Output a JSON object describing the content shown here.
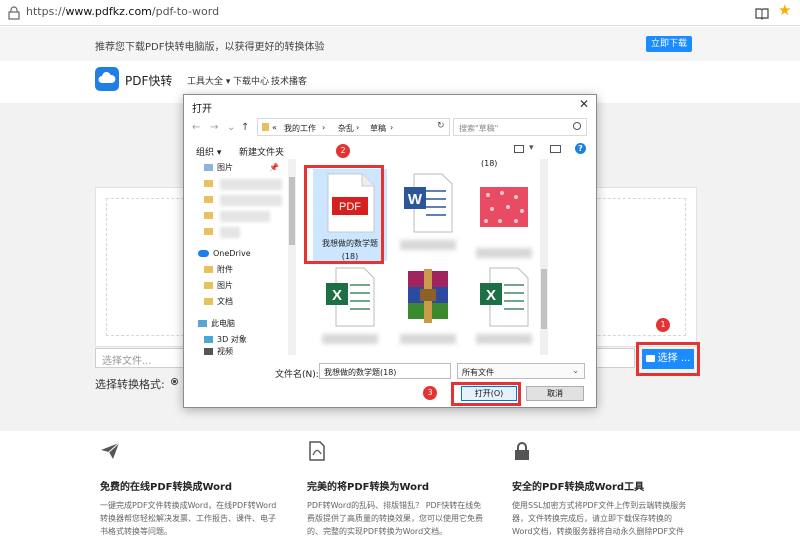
{
  "browser": {
    "url_prefix": "https://",
    "url_domain": "www.pdfkz.com",
    "url_path": "/pdf-to-word"
  },
  "promo": {
    "text": "推荐您下载PDF快转电脑版，以获得更好的转换体验",
    "button": "立即下载"
  },
  "header": {
    "logo": "PDF快转",
    "nav": [
      "工具大全 ▾",
      "下载中心",
      "技术播客"
    ]
  },
  "upload": {
    "placeholder": "选择文件...",
    "choose_button": "选择 ...",
    "format_label": "选择转换格式:"
  },
  "dialog": {
    "title": "打开",
    "breadcrumb": [
      "«",
      "我的工作",
      "›",
      "杂乱",
      "›",
      "草稿",
      "›"
    ],
    "search_placeholder": "搜索\"草稿\"",
    "toolbar": {
      "organize": "组织 ▾",
      "new_folder": "新建文件夹"
    },
    "tree": {
      "pictures": "图片",
      "onedrive": "OneDrive",
      "attachments": "附件",
      "pictures2": "图片",
      "documents": "文档",
      "this_pc": "此电脑",
      "objects3d": "3D 对象",
      "videos": "视频"
    },
    "files": {
      "partial_count": "(18)",
      "selected_name": "我想做的数学题",
      "selected_count": "(18)"
    },
    "filename_label": "文件名(N):",
    "filename_value": "我想做的数学题(18)",
    "filetype": "所有文件",
    "open_button": "打开(O)",
    "cancel_button": "取消"
  },
  "badges": [
    "1",
    "2",
    "3"
  ],
  "features": [
    {
      "title": "免费的在线PDF转换成Word",
      "desc": "一键完成PDF文件转换成Word，在线PDF转Word转换器帮您轻松解决发票、工作报告、课件、电子书格式转换等问题。"
    },
    {
      "title": "完美的将PDF转换为Word",
      "desc": "PDF转Word的乱码、排版错乱？ PDF快转在线免费版提供了高质量的转换效果，您可以使用它免费的、完整的实现PDF转换为Word文档。"
    },
    {
      "title": "安全的PDF转换成Word工具",
      "desc": "使用SSL加密方式将PDF文件上传到云端转换服务器，文件转换完成后，请立即下载保存转换的Word文档，转换服务器将自动永久删除PDF文件和Word文档以确保您的文件安全。"
    }
  ],
  "colors": {
    "accent": "#1a8cff",
    "highlight": "#e53333"
  }
}
